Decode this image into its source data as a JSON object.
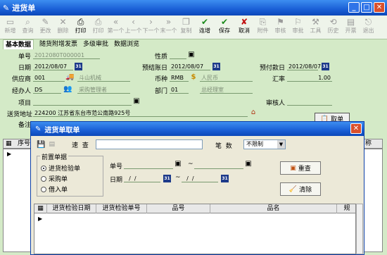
{
  "window": {
    "title": "进货单"
  },
  "toolbar": [
    {
      "label": "新增",
      "icon": "new-icon",
      "enabled": false
    },
    {
      "label": "查询",
      "icon": "query-icon",
      "enabled": false
    },
    {
      "label": "更改",
      "icon": "edit-icon",
      "enabled": false
    },
    {
      "label": "删除",
      "icon": "delete-icon",
      "enabled": false
    },
    {
      "label": "打印",
      "icon": "print-icon",
      "enabled": true
    },
    {
      "label": "打印",
      "icon": "print-icon",
      "enabled": false
    },
    {
      "label": "第一个",
      "icon": "first-icon",
      "enabled": false
    },
    {
      "label": "上一个",
      "icon": "prev-icon",
      "enabled": false
    },
    {
      "label": "下一个",
      "icon": "next-icon",
      "enabled": false
    },
    {
      "label": "末一个",
      "icon": "last-icon",
      "enabled": false
    },
    {
      "label": "复制",
      "icon": "copy-icon",
      "enabled": false
    },
    {
      "label": "连增",
      "icon": "check-icon",
      "enabled": true
    },
    {
      "label": "保存",
      "icon": "save-icon",
      "enabled": true
    },
    {
      "label": "取消",
      "icon": "cancel-icon",
      "enabled": true
    },
    {
      "label": "附件",
      "icon": "attach-icon",
      "enabled": false
    },
    {
      "label": "审核",
      "icon": "audit-icon",
      "enabled": false
    },
    {
      "label": "审批",
      "icon": "approve-icon",
      "enabled": false
    },
    {
      "label": "工具",
      "icon": "tools-icon",
      "enabled": false
    },
    {
      "label": "历史",
      "icon": "history-icon",
      "enabled": false
    },
    {
      "label": "开票",
      "icon": "invoice-icon",
      "enabled": false
    },
    {
      "label": "退出",
      "icon": "exit-icon",
      "enabled": false
    }
  ],
  "tabs": [
    "基本数据",
    "随货附增发票",
    "多级审批",
    "数据浏览"
  ],
  "form": {
    "doc_no_label": "单号",
    "doc_no": "2012080T000001",
    "nature_label": "性质",
    "date_label": "日期",
    "date": "2012/08/07",
    "settle_label": "预结账日",
    "settle": "2012/08/07",
    "prepay_label": "预付款日",
    "prepay": "2012/08/07",
    "supplier_label": "供应商",
    "supplier_code": "001",
    "supplier_name": "斗山机械",
    "currency_label": "币种",
    "currency_code": "RMB",
    "currency_name": "人民币",
    "rate_label": "汇率",
    "rate": "1.00",
    "handler_label": "经办人",
    "handler_code": "DS",
    "handler_name": "采购管理者",
    "dept_label": "部门",
    "dept_code": "01",
    "dept_name": "总经理室",
    "project_label": "项目",
    "reviewer_label": "审核人",
    "address_label": "送货地址",
    "address": "224200  江苏省东台市范公南路925号",
    "remark_label": "备注",
    "fetch_btn": "取单"
  },
  "grid": {
    "col1": "序号",
    "col_last": "称"
  },
  "dialog": {
    "title": "进货单取单",
    "quick_label": "速  查",
    "count_label": "笔  数",
    "count_value": "不限制",
    "group_title": "前置单据",
    "options": [
      "进货检验单",
      "采购单",
      "借入单"
    ],
    "no_label": "单号",
    "tilde": "~",
    "date_label": "日期",
    "date_from": "  /  /",
    "date_to": "  /  /",
    "requery": "重查",
    "clear": "清除",
    "cols": [
      "进货检验日期",
      "进货检验单号",
      "品号",
      "品名",
      "规"
    ]
  }
}
